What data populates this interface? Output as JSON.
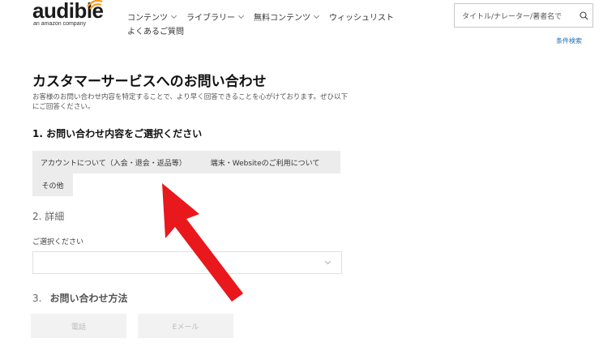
{
  "header": {
    "logo": {
      "brand": "audible",
      "tagline": "an amazon company"
    },
    "nav": [
      {
        "label": "コンテンツ",
        "has_dropdown": true
      },
      {
        "label": "ライブラリー",
        "has_dropdown": true
      },
      {
        "label": "無料コンテンツ",
        "has_dropdown": true
      },
      {
        "label": "ウィッシュリスト",
        "has_dropdown": false
      }
    ],
    "faq": "よくあるご質問",
    "search": {
      "placeholder": "タイトル/ナレーター/著者名で",
      "icon": "search-icon"
    },
    "advanced_search": "条件検索"
  },
  "main": {
    "title": "カスタマーサービスへのお問い合わせ",
    "description": "お客様のお問い合わせ内容を特定することで、より早く回答できることを心がけております。ぜひ以下にご回答ください。",
    "step1": {
      "heading": "1. お問い合わせ内容をご選択ください",
      "options": [
        "アカウントについて（入会・退会・返品等）",
        "端末・Websiteのご利用について",
        "その他"
      ]
    },
    "step2": {
      "heading": "2.  詳細",
      "select_label": "ご選択ください",
      "select_value": ""
    },
    "step3": {
      "number": "3.",
      "heading": "お問い合わせ方法",
      "methods": [
        "電話",
        "Eメール"
      ]
    }
  },
  "colors": {
    "logo_accent": "#f7991c",
    "link": "#1f6fb5",
    "option_bg": "#ececec",
    "annotation_arrow": "#e8181c"
  }
}
